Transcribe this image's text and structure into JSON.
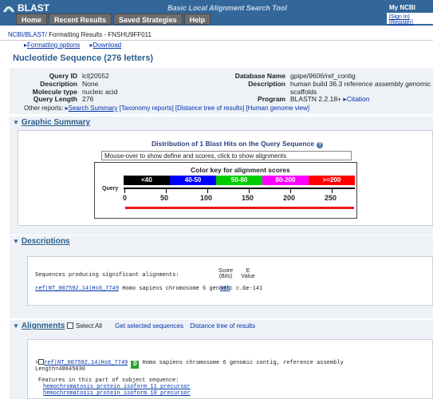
{
  "header": {
    "app_title": "BLAST",
    "subtitle": "Basic Local Alignment Search Tool",
    "tabs": [
      "Home",
      "Recent Results",
      "Saved Strategies",
      "Help"
    ],
    "myncbi": {
      "title": "My NCBI",
      "sign_in": "[Sign In]",
      "register": "[Register]"
    }
  },
  "breadcrumb": {
    "ncbi": "NCBI/",
    "blast": "BLAST/",
    "rest": " Formatting Results - FNSHU9FF011"
  },
  "links": {
    "formatting": "Formatting options",
    "download": "Download"
  },
  "page_title": "Nucleotide Sequence (276 letters)",
  "query": {
    "left": [
      {
        "label": "Query ID",
        "value": "lcl|20552"
      },
      {
        "label": "Description",
        "value": "None"
      },
      {
        "label": "Molecule type",
        "value": "nucleic acid"
      },
      {
        "label": "Query Length",
        "value": "276"
      }
    ],
    "right": [
      {
        "label": "Database Name",
        "value": "gpipe/9606/ref_contig"
      },
      {
        "label": "Description",
        "value": "human build 36.3 reference assembly genomic"
      },
      {
        "label": "",
        "value": "scaffolds"
      },
      {
        "label": "Program",
        "value": "BLASTN 2.2.18+"
      }
    ],
    "citation": "Citation",
    "other_reports_label": "Other reports:",
    "other_reports": [
      "Search Summary",
      "[Taxonomy reports]",
      "[Distance tree of results]",
      "[Human genome view]"
    ]
  },
  "graphic_summary": {
    "heading": "Graphic Summary",
    "title": "Distribution of 1 Blast Hits on the Query Sequence",
    "help": "?",
    "mouse_text": "Mouse-over to show define and scores, click to show alignments",
    "key_title": "Color key for alignment scores",
    "keys": [
      {
        "label": "<40",
        "color": "#000000"
      },
      {
        "label": "40-50",
        "color": "#0000ff"
      },
      {
        "label": "50-80",
        "color": "#00cc00"
      },
      {
        "label": "80-200",
        "color": "#ff00ff"
      },
      {
        "label": ">=200",
        "color": "#ff0000"
      }
    ],
    "query_label": "Query",
    "ticks": [
      "0",
      "50",
      "100",
      "150",
      "200",
      "250"
    ],
    "hit": {
      "start": 1,
      "end": 276,
      "color": "#e8161a"
    }
  },
  "descriptions": {
    "heading": "Descriptions",
    "producing": "Sequences producing significant alignments:",
    "score_hdr": "Score",
    "bits_hdr": "(Bits)",
    "e_hdr": "E",
    "value_hdr": "Value",
    "rows": [
      {
        "id": "ref|NT_007592.14|Hs6_7749",
        "desc": "Homo sapiens chromosome 6 genomic c...",
        "score": "505",
        "evalue": "6e-141"
      }
    ]
  },
  "alignments": {
    "heading": "Alignments",
    "select_all": "Select All",
    "get_selected": "Get selected sequences",
    "distance_tree": "Distance tree of results",
    "hit_id": "ref|NT_007592.14|Hs6_7749",
    "badge": "D",
    "hit_desc": "Homo sapiens chromosome 6 genomic contig, reference assembly",
    "length": "Length=48845030",
    "features_label": "Features in this part of subject sequence:",
    "features": [
      "hemochromatosis protein isoform 11 precursor",
      "hemochromatosis protein isoform 10 precursor"
    ]
  }
}
